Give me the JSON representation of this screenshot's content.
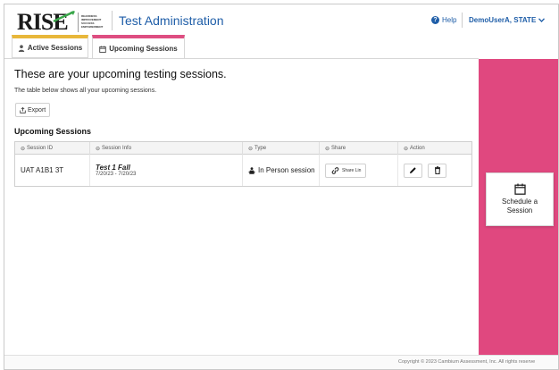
{
  "header": {
    "logo_text": "RISE",
    "logo_subtext": [
      "READINESS",
      "IMPROVEMENT",
      "SUCCESS",
      "EMPOWERMENT"
    ],
    "app_title": "Test Administration",
    "help_label": "Help",
    "user_label": "DemoUserA, STATE"
  },
  "tabs": [
    {
      "label": "Active Sessions",
      "accent": "#e8b73a",
      "icon": "person-icon"
    },
    {
      "label": "Upcoming Sessions",
      "accent": "#de4e81",
      "icon": "calendar-icon",
      "active": true
    }
  ],
  "main": {
    "title": "These are your upcoming testing sessions.",
    "subtitle": "The table below shows all your upcoming sessions.",
    "export_label": "Export",
    "section_heading": "Upcoming Sessions"
  },
  "table": {
    "columns": [
      "Session ID",
      "Session Info",
      "Type",
      "Share",
      "Action"
    ],
    "rows": [
      {
        "session_id": "UAT A1B1 3T",
        "session_name": "Test 1 Fall",
        "session_dates": "7/20/23 - 7/20/23",
        "type": "In Person session",
        "share_label": "Share Lin"
      }
    ]
  },
  "schedule": {
    "label_line1": "Schedule a",
    "label_line2": "Session"
  },
  "footer": {
    "copyright": "Copyright © 2023 Cambium Assessment, Inc. All rights reserve"
  },
  "colors": {
    "brand_blue": "#1f5ea8",
    "pink_rail": "#e0487f",
    "active_tab_yellow": "#e8b73a"
  }
}
